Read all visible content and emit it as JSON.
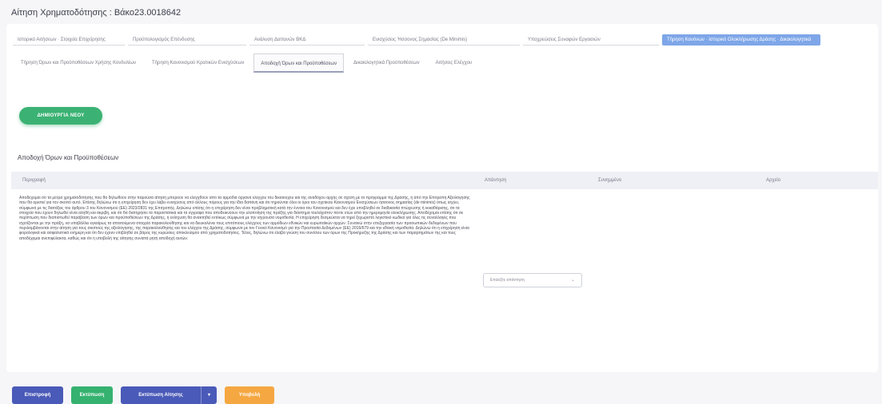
{
  "page": {
    "title": "Αίτηση Χρηματοδότησης : Bάκο23.0018642"
  },
  "tabs_row1": [
    {
      "label": "Ιστορικό Αιτήσεων · Στοιχεία Επιχείρησης",
      "active": false
    },
    {
      "label": "Προϋπολογισμός Επένδυσης",
      "active": false
    },
    {
      "label": "Ανάλυση Δαπανών ΒΚΔ",
      "active": false
    },
    {
      "label": "Ενισχύσεις Ήσσονος Σημασίας (De Minimis)",
      "active": false
    },
    {
      "label": "Υποχρεώσεις Συναφών Εργασιών",
      "active": false
    },
    {
      "label": "Τήρηση Κανόνων · Ιστορικό Ολοκλήρωσης Δράσης · Δικαιολογητικά",
      "active": true
    }
  ],
  "tabs_row2": [
    {
      "label": "Τήρηση Όρων και Προϋποθέσεων Χρήσης Κονδυλίων",
      "active": false
    },
    {
      "label": "Τήρηση Κανονισμού Κρατικών Ενισχύσεων",
      "active": false
    },
    {
      "label": "Αποδοχή Όρων και Προϋποθέσεων",
      "active": true
    },
    {
      "label": "Δικαιολογητικά Προϋποθέσεων",
      "active": false
    },
    {
      "label": "Αιτήσεις Ελέγχου",
      "active": false
    }
  ],
  "create_button": {
    "label": "ΔΗΜΙΟΥΡΓΙΑ ΝΕΟΥ"
  },
  "section": {
    "title": "Αποδοχή Όρων και Προϋποθέσεων"
  },
  "table": {
    "headers": {
      "description": "Περιγραφή",
      "answer": "Απάντηση",
      "attachment": "Συνημμένο",
      "actions": "Αρχείο"
    },
    "terms_text": "Αποδέχομαι ότι τα μέτρα χρηματοδότησης που θα δηλωθούν στην παρούσα αίτηση μπορούν να ελεγχθούν από τα αρμόδια όργανα ελέγχου του δικαιούχου και της αναδόχου αρχής σε σχέση με το πρόγραμμα της Δράσης, ή από την Επιτροπή Αξιολόγησης που θα οριστεί για τον σκοπό αυτό. Επίσης δηλώνω ότι η επιχείρηση δεν έχει λάβει ενισχύσεις από άλλους πόρους για την ίδια δαπάνη και ότι τηρούνται όλοι οι όροι του σχετικού Κανονισμού Ενισχύσεων ήσσονος σημασίας (de minimis) όπως ισχύει, σύμφωνα με τις διατάξεις του άρθρου 3 του Κανονισμού (ΕΕ) 2023/2831 της Επιτροπής. Δηλώνω επίσης ότι η επιχείρηση δεν είναι προβληματική κατά την έννοια του Κανονισμού και δεν έχει υποβληθεί σε διαδικασία πτώχευσης ή εκκαθάρισης, ότι τα στοιχεία που έχουν δηλωθεί είναι αληθή και ακριβή, και ότι θα διατηρήσει τα παραστατικά και τα έγγραφα που αποδεικνύουν την υλοποίηση της πράξης για διάστημα τουλάχιστον πέντε ετών από την ημερομηνία ολοκλήρωσης. Αποδέχομαι επίσης ότι σε περίπτωση που διαπιστωθεί παράβαση των όρων και προϋποθέσεων της Δράσης, η ενίσχυση θα ανακτηθεί εντόκως σύμφωνα με την ισχύουσα νομοθεσία. Η επιχείρηση δεσμεύεται να τηρεί ξεχωριστό λογιστικό κωδικό για όλες τις συναλλαγές που σχετίζονται με την πράξη, να υποβάλλει εγκαίρως τα απαιτούμενα στοιχεία παρακολούθησης και να διευκολύνει τους επιτόπιους ελέγχους των αρμόδιων εθνικών και ευρωπαϊκών αρχών. Συναινώ στην επεξεργασία των προσωπικών δεδομένων που περιλαμβάνονται στην αίτηση για τους σκοπούς της αξιολόγησης, της παρακολούθησης και του ελέγχου της Δράσης, σύμφωνα με τον Γενικό Κανονισμό για την Προστασία Δεδομένων (ΕΕ) 2016/679 και την εθνική νομοθεσία. Δηλώνω ότι η επιχείρηση είναι φορολογικά και ασφαλιστικά ενήμερη και ότι δεν έχουν επιβληθεί σε βάρος της κυρώσεις αποκλεισμού από χρηματοδοτήσεις. Τέλος, δηλώνω ότι έλαβα γνώση του συνόλου των όρων της Προκήρυξης της Δράσης και των παραρτημάτων της και τους αποδέχομαι ανεπιφύλακτα, καθώς και ότι η υποβολή της αίτησης συνιστά ρητή αποδοχή αυτών.",
    "answer_placeholder": "Επιλέξτε απάντηση"
  },
  "bottom_actions": {
    "back": "Επιστροφή",
    "save": "Εκτύπωση",
    "print": "Εκτύπωση Αίτησης",
    "submit": "Υποβολή"
  },
  "colors": {
    "accent_green": "#3bb273",
    "accent_blue": "#4a5ab8",
    "accent_orange": "#f5a742",
    "active_tab": "#7ea6e8"
  }
}
